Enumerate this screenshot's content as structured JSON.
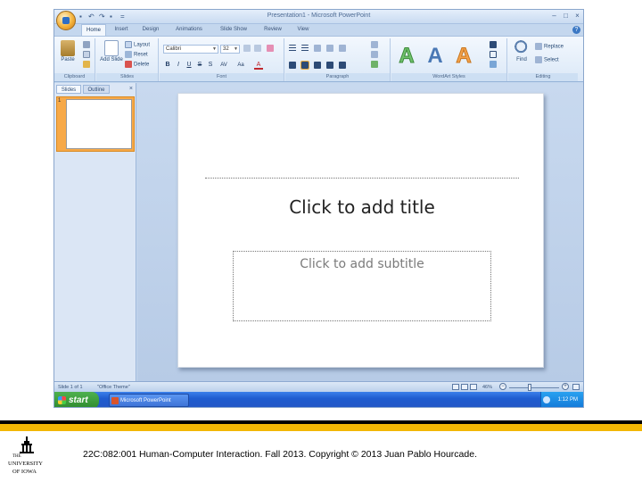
{
  "window": {
    "title": "Presentation1 - Microsoft PowerPoint",
    "controls": {
      "minimize": "–",
      "maximize": "□",
      "close": "×"
    }
  },
  "quick_access": {
    "save": "▪",
    "undo": "↶",
    "redo": "↷",
    "print": "▪",
    "more": "="
  },
  "ribbon": {
    "tabs": [
      "Home",
      "Insert",
      "Design",
      "Animations",
      "Slide Show",
      "Review",
      "View"
    ],
    "active_tab": "Home",
    "help": "?",
    "clipboard": {
      "paste_label": "Paste",
      "group_label": "Clipboard"
    },
    "slides": {
      "add_label": "Add Slide",
      "layout_label": "Layout",
      "reset_label": "Reset",
      "delete_label": "Delete",
      "group_label": "Slides"
    },
    "font": {
      "font_name": "Calibri",
      "font_size": "32",
      "group_label": "Font",
      "bold": "B",
      "italic": "I",
      "underline": "U",
      "strike": "S",
      "shadow": "S",
      "spacing": "AV",
      "case": "Aa",
      "color": "A"
    },
    "paragraph": {
      "group_label": "Paragraph"
    },
    "wordart": {
      "group_label": "WordArt Styles",
      "style_letter": "A"
    },
    "editing": {
      "find_label": "Find",
      "replace_label": "Replace",
      "select_label": "Select",
      "group_label": "Editing"
    }
  },
  "slides_pane": {
    "tab_slides": "Slides",
    "tab_outline": "Outline",
    "close": "×",
    "slide_number": "1"
  },
  "slide": {
    "title_placeholder": "Click to add title",
    "subtitle_placeholder": "Click to add subtitle"
  },
  "statusbar": {
    "slide_info": "Slide 1 of 1",
    "theme": "\"Office Theme\"",
    "zoom": "46%",
    "zoom_out": "−",
    "zoom_in": "+"
  },
  "taskbar": {
    "start_label": "start",
    "task_label": "Microsoft PowerPoint",
    "clock": "1:12 PM"
  },
  "footer": {
    "text": "22C:082:001 Human-Computer Interaction. Fall 2013. Copyright © 2013 Juan Pablo Hourcade.",
    "logo_the": "THE",
    "logo_university": "UNIVERSITY",
    "logo_of_iowa": "OF IOWA"
  },
  "colors": {
    "gold": "#f2b705",
    "ribbon_blue": "#c4d7ee",
    "wordart_green": "#6fc16b",
    "wordart_blue": "#4a78b5",
    "wordart_orange": "#f3a14a",
    "selection_orange": "#f7a948"
  }
}
